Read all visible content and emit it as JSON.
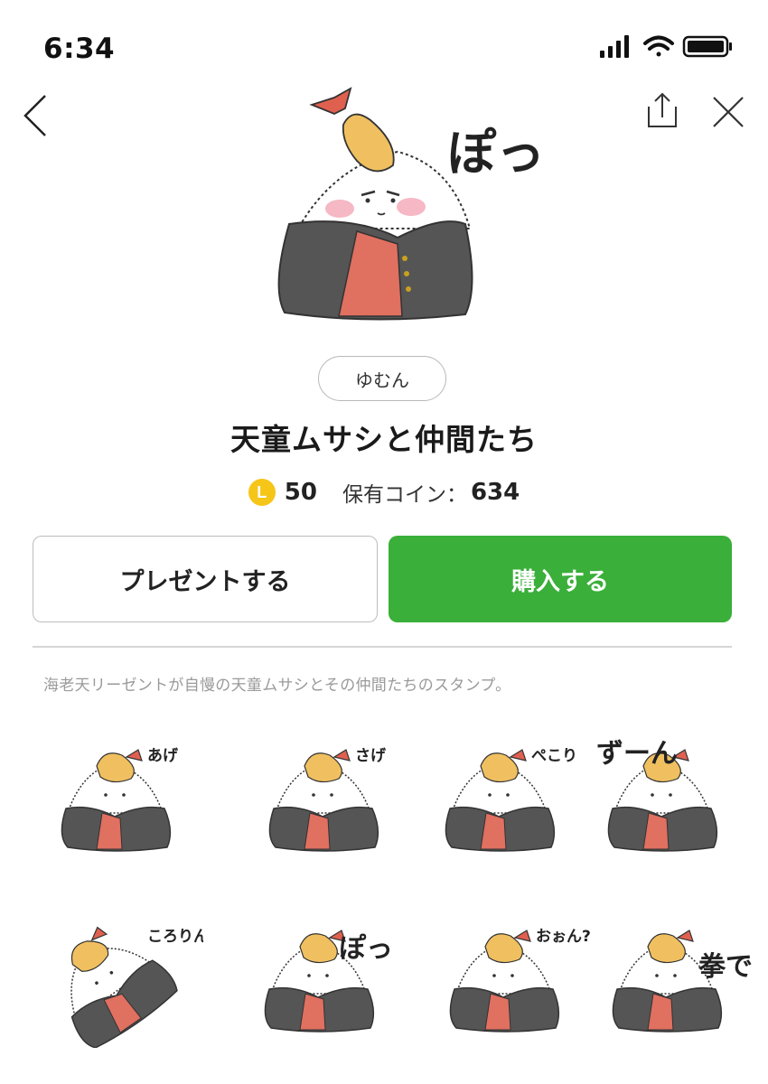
{
  "status_bar": {
    "time": "6:34"
  },
  "nav": {
    "back_icon": "chevron-left-icon",
    "share_icon": "share-icon",
    "close_icon": "close-icon"
  },
  "product": {
    "hero_text": "ぽっ",
    "author": "ゆむん",
    "title": "天童ムサシと仲間たち",
    "coin_glyph": "L",
    "price": "50",
    "owned_label": "保有コイン：",
    "owned_value": "634",
    "description": "海老天リーゼントが自慢の天童ムサシとその仲間たちのスタンプ。"
  },
  "actions": {
    "gift_label": "プレゼントする",
    "buy_label": "購入する"
  },
  "colors": {
    "buy_green": "#3aaf3a",
    "coin_yellow": "#f5c518",
    "jacket_gray": "#555555",
    "shirt_red": "#e07060",
    "shrimp_orange": "#f0c060"
  },
  "stickers": [
    {
      "caption": "あげ"
    },
    {
      "caption": "さげ"
    },
    {
      "caption": "ぺこり"
    },
    {
      "caption": "ずーん"
    },
    {
      "caption": "ころりん"
    },
    {
      "caption": "ぽっ"
    },
    {
      "caption": "おぉん?"
    },
    {
      "caption": "拳で"
    }
  ]
}
